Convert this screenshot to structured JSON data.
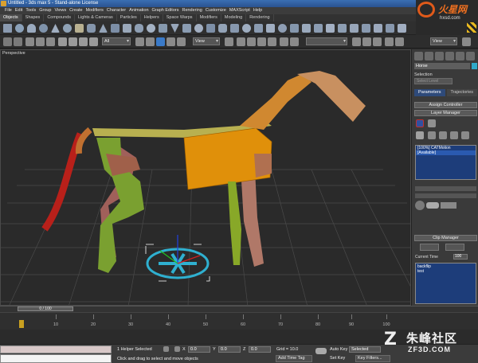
{
  "window": {
    "title": "Untitled - 3ds max 5 - Stand-alone License"
  },
  "menu": [
    "File",
    "Edit",
    "Tools",
    "Group",
    "Views",
    "Create",
    "Modifiers",
    "Character",
    "Animation",
    "Graph Editors",
    "Rendering",
    "Customize",
    "MAXScript",
    "Help"
  ],
  "tabs": [
    {
      "label": "Objects",
      "state": "active"
    },
    {
      "label": "Shapes",
      "state": "normal"
    },
    {
      "label": "Compounds",
      "state": "normal"
    },
    {
      "label": "Lights & Cameras",
      "state": "normal"
    },
    {
      "label": "Particles",
      "state": "normal"
    },
    {
      "label": "Helpers",
      "state": "normal"
    },
    {
      "label": "Space Warps",
      "state": "normal"
    },
    {
      "label": "Modifiers",
      "state": "normal"
    },
    {
      "label": "Modeling",
      "state": "normal"
    },
    {
      "label": "Rendering",
      "state": "normal"
    }
  ],
  "toolbar": {
    "filter_value": "All",
    "ref_coord_value": "View",
    "named_sel_value": "",
    "render_type_value": "View"
  },
  "logo": {
    "text": "火星网",
    "url": "hxsd.com"
  },
  "viewport": {
    "label": "Perspective"
  },
  "command_panel": {
    "object_name": "Horse",
    "object_color": "#2fa8c8",
    "selection_label": "Selection",
    "selection_value": "Select Level",
    "tab_parameters": "Parameters",
    "tab_trajectories": "Trajectories",
    "assign_controller": "Assign Controller",
    "layer_manager": "Layer Manager",
    "layers": [
      {
        "text": "[100%] CATMotion",
        "selected": false
      },
      {
        "text": "[Available]",
        "selected": true
      }
    ],
    "clip_manager": "Clip Manager",
    "current_time_label": "Current Time",
    "current_time_value": "100",
    "clips": [
      "backflip",
      "test"
    ]
  },
  "timeline": {
    "slider_text": "0 / 100",
    "ticks": [
      "10",
      "20",
      "30",
      "40",
      "50",
      "60",
      "70",
      "80",
      "90",
      "100"
    ]
  },
  "status": {
    "selected_text": "1 Helper Selected",
    "prompt_text": "Click and drag to select and move objects",
    "x_label": "X",
    "x_value": "0.0",
    "y_label": "Y",
    "y_value": "0.0",
    "z_label": "Z",
    "z_value": "0.0",
    "grid_text": "Grid = 10.0",
    "add_time_tag": "Add Time Tag",
    "auto_key": "Auto Key",
    "auto_key_value": "Selected",
    "set_key": "Set Key",
    "key_filters": "Key Filters..."
  },
  "watermark": {
    "mark": "Z",
    "cn": "朱峰社区",
    "url": "ZF3D.COM"
  }
}
